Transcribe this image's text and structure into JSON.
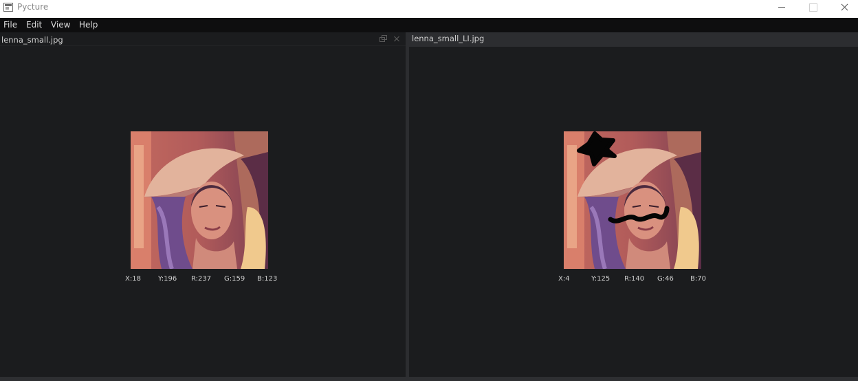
{
  "window": {
    "title": "Pycture"
  },
  "menu": [
    "File",
    "Edit",
    "View",
    "Help"
  ],
  "left_pane": {
    "tab_title": "lenna_small.jpg",
    "readout": {
      "x": "X:18",
      "y": "Y:196",
      "r": "R:237",
      "g": "G:159",
      "b": "B:123"
    }
  },
  "right_pane": {
    "tab_title": "lenna_small_LI.jpg",
    "readout": {
      "x": "X:4",
      "y": "Y:125",
      "r": "R:140",
      "g": "G:46",
      "b": "B:70"
    }
  },
  "colors": {
    "background": "#1b1c1e",
    "menubar": "#0e0e0f",
    "tab_active": "#2c2d30",
    "text": "#cfcfcf"
  },
  "icons": [
    "app-icon",
    "minimize-icon",
    "maximize-icon",
    "close-icon",
    "float-pane-icon",
    "close-pane-icon"
  ]
}
